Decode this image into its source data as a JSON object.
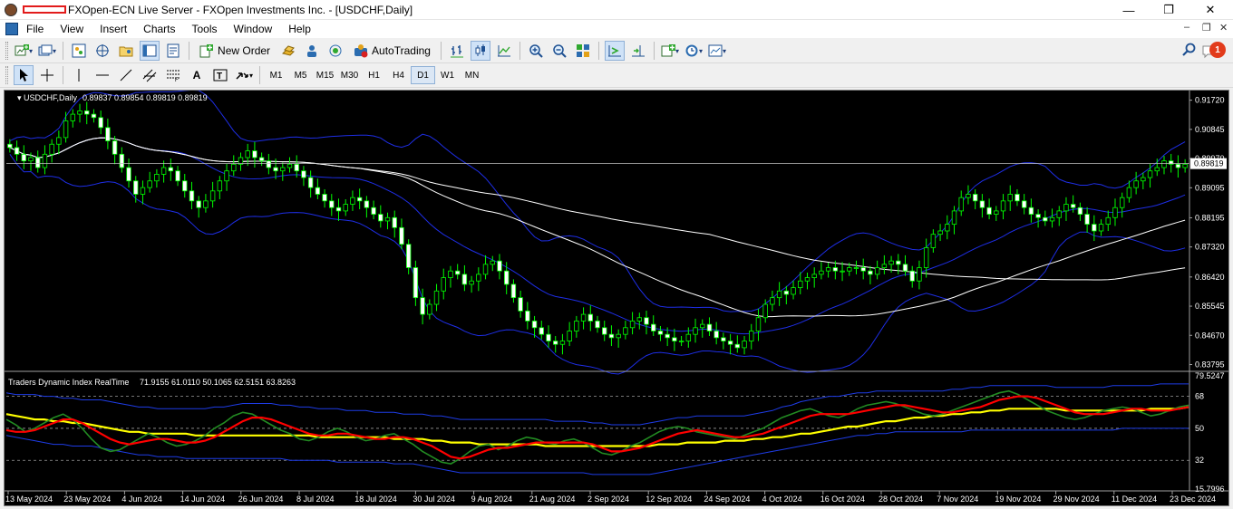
{
  "window": {
    "title": "FXOpen-ECN Live Server - FXOpen Investments Inc. - [USDCHF,Daily]",
    "minimize": "—",
    "maximize": "❐",
    "close": "✕"
  },
  "menu": {
    "items": [
      "File",
      "View",
      "Insert",
      "Charts",
      "Tools",
      "Window",
      "Help"
    ]
  },
  "toolbar": {
    "new_order_label": "New Order",
    "autotrading_label": "AutoTrading",
    "notification_count": "1"
  },
  "timeframes": [
    "M1",
    "M5",
    "M15",
    "M30",
    "H1",
    "H4",
    "D1",
    "W1",
    "MN"
  ],
  "active_timeframe": "D1",
  "chart_data": [
    {
      "type": "candlestick",
      "title": "USDCHF,Daily",
      "ohlc_label": "0.89837 0.89854 0.89819 0.89819",
      "current_price_label": "0.89819",
      "price_axis_ticks": [
        "0.91720",
        "0.90845",
        "0.89970",
        "0.89095",
        "0.88195",
        "0.87320",
        "0.86420",
        "0.85545",
        "0.84670",
        "0.83795"
      ],
      "ylim": [
        0.837,
        0.919
      ],
      "current_price": 0.89819,
      "overlays": [
        "Bollinger Bands",
        "Moving Average",
        "Moving Average"
      ],
      "colors": {
        "bull_body": "#000000",
        "bear_body": "#ffffff",
        "wick": "#00ff00",
        "bands": "#1e2ee6",
        "ma": "#ffffff",
        "grid": "#000000"
      },
      "candle_closes": [
        0.903,
        0.901,
        0.899,
        0.9,
        0.897,
        0.901,
        0.904,
        0.906,
        0.911,
        0.913,
        0.914,
        0.913,
        0.912,
        0.909,
        0.905,
        0.901,
        0.897,
        0.893,
        0.889,
        0.891,
        0.893,
        0.895,
        0.897,
        0.896,
        0.893,
        0.89,
        0.887,
        0.885,
        0.887,
        0.89,
        0.893,
        0.896,
        0.898,
        0.9,
        0.902,
        0.9,
        0.899,
        0.897,
        0.896,
        0.897,
        0.898,
        0.896,
        0.894,
        0.891,
        0.889,
        0.887,
        0.885,
        0.884,
        0.886,
        0.888,
        0.887,
        0.885,
        0.883,
        0.881,
        0.882,
        0.879,
        0.874,
        0.867,
        0.858,
        0.853,
        0.856,
        0.86,
        0.864,
        0.866,
        0.865,
        0.862,
        0.863,
        0.865,
        0.868,
        0.869,
        0.866,
        0.862,
        0.858,
        0.854,
        0.851,
        0.849,
        0.847,
        0.845,
        0.844,
        0.845,
        0.848,
        0.851,
        0.853,
        0.851,
        0.849,
        0.847,
        0.846,
        0.847,
        0.849,
        0.851,
        0.852,
        0.85,
        0.848,
        0.847,
        0.846,
        0.845,
        0.845,
        0.847,
        0.849,
        0.85,
        0.848,
        0.846,
        0.845,
        0.844,
        0.843,
        0.845,
        0.848,
        0.852,
        0.856,
        0.858,
        0.86,
        0.859,
        0.861,
        0.863,
        0.864,
        0.865,
        0.866,
        0.867,
        0.866,
        0.866,
        0.867,
        0.867,
        0.866,
        0.865,
        0.867,
        0.868,
        0.869,
        0.868,
        0.866,
        0.863,
        0.867,
        0.873,
        0.877,
        0.878,
        0.88,
        0.884,
        0.888,
        0.889,
        0.887,
        0.885,
        0.883,
        0.884,
        0.887,
        0.889,
        0.887,
        0.885,
        0.883,
        0.882,
        0.881,
        0.882,
        0.884,
        0.886,
        0.885,
        0.883,
        0.88,
        0.878,
        0.88,
        0.882,
        0.885,
        0.888,
        0.891,
        0.893,
        0.894,
        0.896,
        0.897,
        0.899,
        0.898,
        0.897,
        0.898
      ]
    },
    {
      "type": "line",
      "title": "Traders Dynamic Index RealTime",
      "values_label": "71.9155 61.0110 50.1065 62.5151 63.8263",
      "level_ticks": [
        "79.5247",
        "68",
        "50",
        "32",
        "15.7996"
      ],
      "ylim": [
        15.7996,
        79.5247
      ],
      "levels": [
        68,
        50,
        32
      ],
      "series": [
        {
          "color": "#228b22",
          "values": [
            55,
            52,
            48,
            50,
            53,
            56,
            58,
            55,
            50,
            44,
            39,
            37,
            38,
            41,
            44,
            47,
            45,
            42,
            40,
            41,
            43,
            46,
            50,
            53,
            57,
            59,
            58,
            55,
            52,
            49,
            47,
            44,
            43,
            45,
            48,
            50,
            48,
            45,
            43,
            44,
            46,
            47,
            44,
            41,
            37,
            34,
            31,
            30,
            33,
            37,
            40,
            41,
            38,
            40,
            43,
            45,
            44,
            42,
            41,
            43,
            44,
            42,
            39,
            36,
            35,
            37,
            40,
            42,
            45,
            48,
            50,
            51,
            50,
            48,
            47,
            46,
            45,
            44,
            46,
            48,
            50,
            53,
            56,
            58,
            60,
            61,
            59,
            57,
            56,
            58,
            61,
            63,
            64,
            65,
            64,
            62,
            60,
            58,
            57,
            58,
            60,
            62,
            64,
            66,
            68,
            70,
            71,
            69,
            66,
            63,
            60,
            58,
            56,
            55,
            56,
            58,
            60,
            61,
            62,
            61,
            59,
            57,
            58,
            60,
            62,
            63
          ]
        },
        {
          "color": "#ff0000",
          "values": [
            49,
            48,
            48,
            49,
            51,
            53,
            55,
            55,
            53,
            50,
            47,
            44,
            42,
            41,
            42,
            43,
            44,
            44,
            43,
            42,
            42,
            43,
            45,
            48,
            51,
            54,
            56,
            56,
            55,
            53,
            51,
            49,
            47,
            46,
            46,
            47,
            47,
            46,
            45,
            44,
            44,
            45,
            45,
            44,
            42,
            40,
            37,
            34,
            33,
            34,
            36,
            38,
            39,
            39,
            40,
            41,
            42,
            42,
            42,
            42,
            42,
            42,
            41,
            39,
            37,
            37,
            38,
            39,
            41,
            43,
            45,
            47,
            48,
            49,
            48,
            47,
            46,
            45,
            45,
            46,
            47,
            49,
            51,
            53,
            55,
            57,
            58,
            58,
            58,
            58,
            59,
            60,
            61,
            62,
            63,
            63,
            62,
            61,
            60,
            59,
            59,
            60,
            61,
            62,
            64,
            66,
            67,
            68,
            68,
            67,
            65,
            63,
            61,
            59,
            58,
            58,
            58,
            59,
            60,
            61,
            61,
            60,
            60,
            60,
            61,
            62
          ]
        },
        {
          "color": "#ffff00",
          "values": [
            58,
            57,
            56,
            55,
            55,
            54,
            54,
            53,
            53,
            52,
            51,
            50,
            49,
            48,
            48,
            47,
            47,
            47,
            47,
            47,
            46,
            46,
            46,
            46,
            46,
            46,
            46,
            46,
            46,
            46,
            46,
            46,
            46,
            45,
            45,
            45,
            45,
            45,
            45,
            45,
            45,
            44,
            44,
            44,
            44,
            43,
            43,
            42,
            42,
            42,
            41,
            41,
            41,
            41,
            41,
            41,
            41,
            40,
            40,
            40,
            40,
            40,
            40,
            40,
            40,
            40,
            40,
            40,
            40,
            41,
            41,
            41,
            42,
            42,
            42,
            42,
            43,
            43,
            43,
            44,
            44,
            45,
            45,
            46,
            47,
            47,
            48,
            49,
            50,
            51,
            51,
            52,
            53,
            54,
            54,
            55,
            56,
            56,
            57,
            57,
            58,
            58,
            59,
            59,
            60,
            60,
            61,
            61,
            61,
            61,
            61,
            61,
            60,
            60,
            60,
            60,
            60,
            60,
            60,
            60,
            60,
            61,
            61,
            61,
            61,
            62
          ]
        },
        {
          "color": "#1e3ce6",
          "values": [
            70,
            69,
            69,
            69,
            68,
            68,
            67,
            67,
            66,
            66,
            66,
            65,
            64,
            63,
            62,
            62,
            61,
            61,
            61,
            61,
            61,
            61,
            62,
            62,
            63,
            64,
            64,
            64,
            64,
            63,
            63,
            62,
            62,
            61,
            61,
            61,
            60,
            60,
            60,
            59,
            59,
            59,
            58,
            58,
            58,
            57,
            57,
            56,
            55,
            55,
            55,
            55,
            55,
            55,
            55,
            55,
            55,
            55,
            54,
            54,
            54,
            54,
            53,
            53,
            52,
            52,
            52,
            52,
            53,
            54,
            55,
            56,
            56,
            57,
            57,
            57,
            57,
            57,
            57,
            58,
            59,
            60,
            62,
            63,
            65,
            66,
            67,
            68,
            68,
            69,
            70,
            70,
            71,
            71,
            71,
            71,
            71,
            71,
            71,
            71,
            72,
            72,
            73,
            73,
            74,
            74,
            74,
            74,
            74,
            74,
            74,
            73,
            73,
            73,
            73,
            73,
            73,
            74,
            74,
            74,
            74,
            74,
            75,
            75,
            75,
            75
          ]
        },
        {
          "color": "#1e3ce6",
          "values": [
            46,
            45,
            44,
            43,
            42,
            41,
            41,
            40,
            40,
            40,
            39,
            38,
            37,
            36,
            35,
            35,
            34,
            34,
            34,
            33,
            33,
            33,
            33,
            33,
            33,
            33,
            33,
            33,
            33,
            33,
            32,
            32,
            32,
            32,
            32,
            31,
            31,
            31,
            31,
            31,
            31,
            30,
            30,
            30,
            29,
            28,
            27,
            26,
            25,
            25,
            25,
            25,
            25,
            25,
            25,
            25,
            25,
            25,
            25,
            25,
            25,
            25,
            24,
            24,
            24,
            24,
            24,
            24,
            24,
            25,
            26,
            27,
            28,
            29,
            30,
            31,
            32,
            33,
            34,
            35,
            36,
            37,
            38,
            39,
            40,
            41,
            42,
            43,
            44,
            45,
            46,
            46,
            47,
            47,
            48,
            48,
            48,
            48,
            48,
            48,
            48,
            48,
            49,
            49,
            49,
            49,
            49,
            49,
            49,
            49,
            49,
            49,
            49,
            49,
            49,
            49,
            49,
            49,
            50,
            50,
            50,
            50,
            50,
            50,
            50,
            50
          ]
        }
      ]
    }
  ],
  "x_axis_labels": [
    "13 May 2024",
    "23 May 2024",
    "4 Jun 2024",
    "14 Jun 2024",
    "26 Jun 2024",
    "8 Jul 2024",
    "18 Jul 2024",
    "30 Jul 2024",
    "9 Aug 2024",
    "21 Aug 2024",
    "2 Sep 2024",
    "12 Sep 2024",
    "24 Sep 2024",
    "4 Oct 2024",
    "16 Oct 2024",
    "28 Oct 2024",
    "7 Nov 2024",
    "19 Nov 2024",
    "29 Nov 2024",
    "11 Dec 2024",
    "23 Dec 2024"
  ]
}
